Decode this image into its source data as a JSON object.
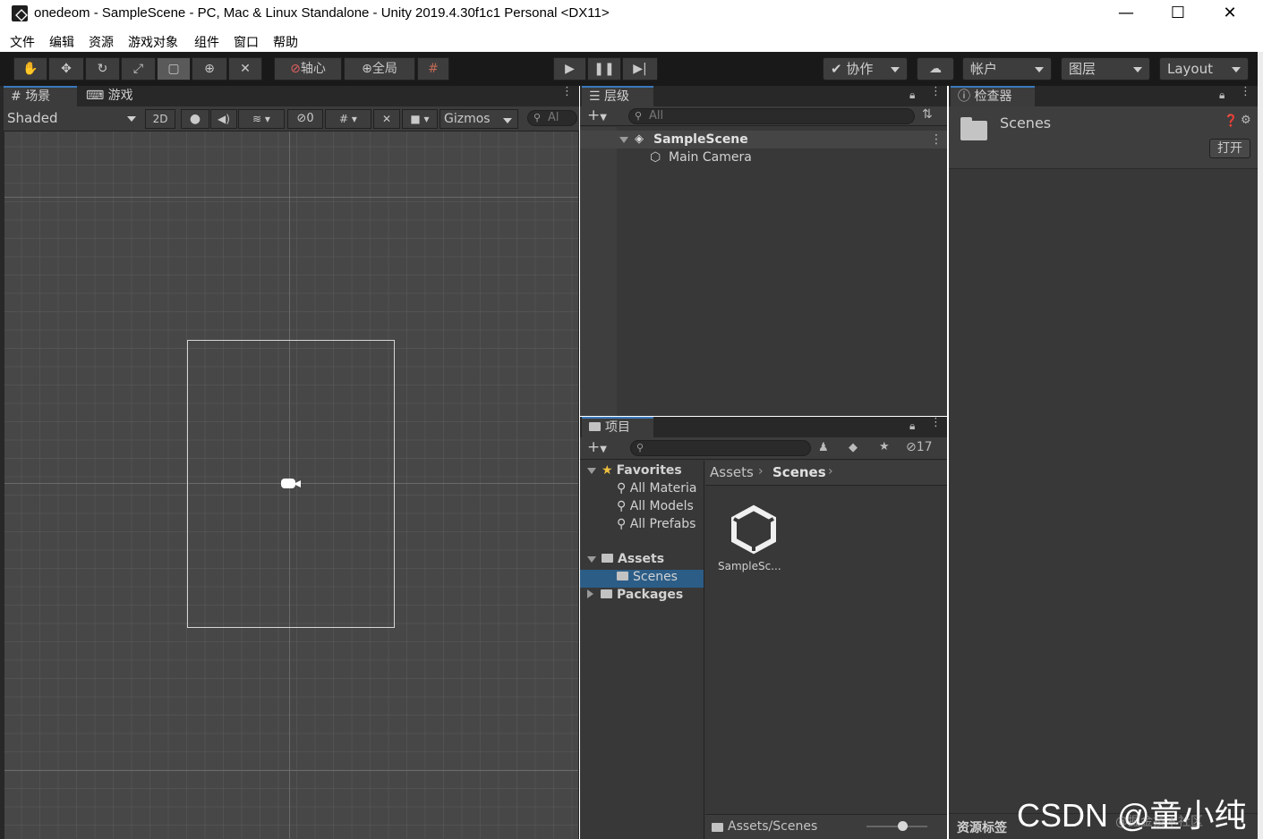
{
  "window": {
    "title": "onedeom - SampleScene - PC, Mac & Linux Standalone - Unity 2019.4.30f1c1 Personal <DX11>",
    "minimize": "—",
    "maximize": "☐",
    "close": "✕"
  },
  "menu": [
    "文件",
    "编辑",
    "资源",
    "游戏对象",
    "组件",
    "窗口",
    "帮助"
  ],
  "toolbar": {
    "pivot_label": "轴心",
    "global_label": "全局",
    "collab_label": "协作",
    "account_label": "帐户",
    "layers_label": "图层",
    "layout_label": "Layout"
  },
  "scene_panel": {
    "tab_scene": "场景",
    "tab_game": "游戏",
    "shading_mode": "Shaded",
    "btn_2d": "2D",
    "hidden_count": "0",
    "gizmos_label": "Gizmos",
    "search_placeholder": "Al"
  },
  "hierarchy": {
    "tab_label": "层级",
    "search_placeholder": "All",
    "scene_name": "SampleScene",
    "objects": [
      "Main Camera"
    ]
  },
  "inspector": {
    "tab_label": "检查器",
    "selected_name": "Scenes",
    "open_button": "打开",
    "asset_labels": "资源标签"
  },
  "project": {
    "tab_label": "项目",
    "hidden_count": "17",
    "favorites_label": "Favorites",
    "favorites": [
      "All Materia",
      "All Models",
      "All Prefabs"
    ],
    "assets_label": "Assets",
    "scenes_label": "Scenes",
    "packages_label": "Packages",
    "breadcrumb_root": "Assets",
    "breadcrumb_current": "Scenes",
    "asset_items": [
      "SampleSc..."
    ],
    "footer_path": "Assets/Scenes"
  },
  "watermark": {
    "main": "CSDN @童小纯",
    "sub": "@掘金技术社区"
  }
}
